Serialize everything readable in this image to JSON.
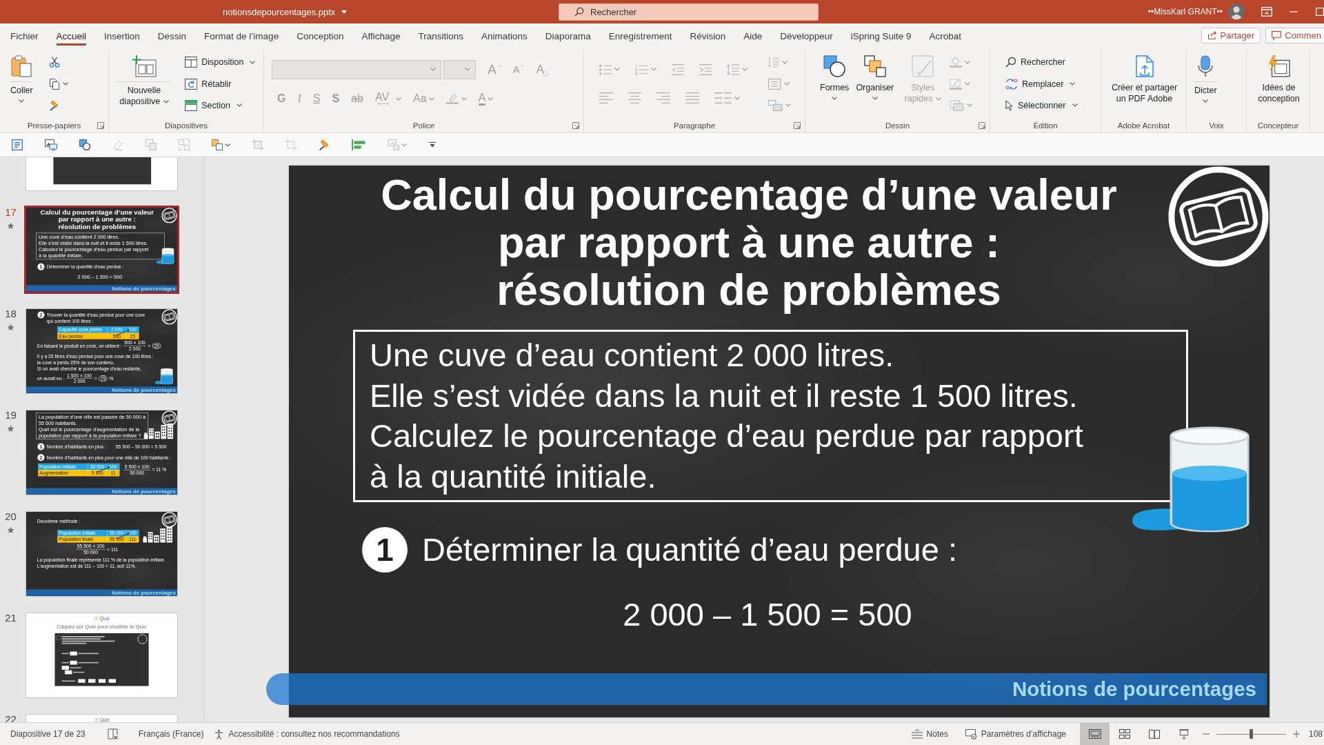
{
  "title_bar": {
    "file_name": "notionsdepourcentages.pptx",
    "search_placeholder": "Rechercher",
    "user_name": "••MissKarl GRANT••"
  },
  "menu_tabs": [
    {
      "label": "Fichier",
      "selected": false
    },
    {
      "label": "Accueil",
      "selected": true
    },
    {
      "label": "Insertion",
      "selected": false
    },
    {
      "label": "Dessin",
      "selected": false
    },
    {
      "label": "Format de l’image",
      "selected": false
    },
    {
      "label": "Conception",
      "selected": false
    },
    {
      "label": "Affichage",
      "selected": false
    },
    {
      "label": "Transitions",
      "selected": false
    },
    {
      "label": "Animations",
      "selected": false
    },
    {
      "label": "Diaporama",
      "selected": false
    },
    {
      "label": "Enregistrement",
      "selected": false
    },
    {
      "label": "Révision",
      "selected": false
    },
    {
      "label": "Aide",
      "selected": false
    },
    {
      "label": "Développeur",
      "selected": false
    },
    {
      "label": "iSpring Suite 9",
      "selected": false
    },
    {
      "label": "Acrobat",
      "selected": false
    }
  ],
  "share_button": "Partager",
  "comments_button": "Commen",
  "ribbon": [
    {
      "label": "Presse-papiers",
      "launcher": true,
      "columns": [
        [
          [
            {
              "kind": "large",
              "label": "Coller",
              "dropdown": true,
              "disabled": false
            }
          ]
        ],
        [
          [
            {
              "kind": "icon",
              "dropdown": false,
              "disabled": false
            }
          ],
          [
            {
              "kind": "icon",
              "dropdown": true,
              "disabled": false
            }
          ],
          [
            {
              "kind": "icon",
              "dropdown": false,
              "disabled": false
            }
          ]
        ]
      ]
    },
    {
      "label": "Diapositives",
      "launcher": false,
      "columns": [
        [
          [
            {
              "kind": "large",
              "label": "Nouvelle diapositive",
              "dropdown": true,
              "disabled": false
            }
          ]
        ],
        [
          [
            {
              "kind": "small",
              "label": "Disposition",
              "dropdown": true,
              "disabled": false
            }
          ],
          [
            {
              "kind": "small",
              "label": "Rétablir",
              "dropdown": false,
              "disabled": false
            }
          ],
          [
            {
              "kind": "small",
              "label": "Section",
              "dropdown": true,
              "disabled": false
            }
          ]
        ]
      ]
    },
    {
      "label": "Police",
      "launcher": true,
      "columns": [
        [
          [
            {
              "kind": "combo",
              "dropdown": true,
              "disabled": true
            },
            {
              "kind": "combo",
              "dropdown": true,
              "disabled": true
            },
            {
              "kind": "glyph",
              "label": "A",
              "dropdown": false,
              "disabled": true
            },
            {
              "kind": "glyph",
              "label": "A",
              "dropdown": false,
              "disabled": true
            },
            {
              "kind": "glyph",
              "label": "A",
              "dropdown": false,
              "disabled": true
            }
          ],
          [
            {
              "kind": "glyph",
              "label": "G",
              "dropdown": false,
              "disabled": true
            },
            {
              "kind": "glyph",
              "label": "I",
              "dropdown": false,
              "disabled": true
            },
            {
              "kind": "glyph",
              "label": "S",
              "dropdown": false,
              "disabled": true
            },
            {
              "kind": "glyph",
              "label": "S",
              "dropdown": false,
              "disabled": true
            },
            {
              "kind": "glyph",
              "label": "ab",
              "dropdown": false,
              "disabled": true
            },
            {
              "kind": "glyph",
              "label": "AV",
              "dropdown": true,
              "disabled": true
            },
            {
              "kind": "glyph",
              "label": "Aa",
              "dropdown": true,
              "disabled": true
            },
            {
              "kind": "icon",
              "dropdown": true,
              "disabled": true
            },
            {
              "kind": "glyph",
              "label": "A",
              "dropdown": true,
              "disabled": true
            }
          ]
        ]
      ]
    },
    {
      "label": "Paragraphe",
      "launcher": true,
      "columns": [
        [
          [
            {
              "kind": "icon",
              "dropdown": true,
              "disabled": true
            },
            {
              "kind": "icon",
              "dropdown": true,
              "disabled": true
            },
            {
              "kind": "icon",
              "dropdown": false,
              "disabled": true
            },
            {
              "kind": "icon",
              "dropdown": false,
              "disabled": true
            },
            {
              "kind": "icon",
              "dropdown": true,
              "disabled": true
            }
          ],
          [
            {
              "kind": "icon",
              "dropdown": false,
              "disabled": true
            },
            {
              "kind": "icon",
              "dropdown": false,
              "disabled": true
            },
            {
              "kind": "icon",
              "dropdown": false,
              "disabled": true
            },
            {
              "kind": "icon",
              "dropdown": false,
              "disabled": true
            },
            {
              "kind": "icon",
              "dropdown": true,
              "disabled": true
            }
          ]
        ],
        [
          [
            {
              "kind": "icon",
              "dropdown": true,
              "disabled": true
            }
          ],
          [
            {
              "kind": "icon",
              "dropdown": true,
              "disabled": true
            }
          ],
          [
            {
              "kind": "icon",
              "dropdown": true,
              "disabled": true
            }
          ]
        ]
      ]
    },
    {
      "label": "Dessin",
      "launcher": true,
      "columns": [
        [
          [
            {
              "kind": "large",
              "label": "Formes",
              "dropdown": true,
              "disabled": false
            }
          ]
        ],
        [
          [
            {
              "kind": "large",
              "label": "Organiser",
              "dropdown": true,
              "disabled": false
            }
          ]
        ],
        [
          [
            {
              "kind": "large",
              "label": "Styles rapides",
              "dropdown": true,
              "disabled": true
            }
          ]
        ],
        [
          [
            {
              "kind": "icon",
              "dropdown": true,
              "disabled": true
            }
          ],
          [
            {
              "kind": "icon",
              "dropdown": true,
              "disabled": true
            }
          ],
          [
            {
              "kind": "icon",
              "dropdown": true,
              "disabled": true
            }
          ]
        ]
      ]
    },
    {
      "label": "Édition",
      "launcher": false,
      "columns": [
        [
          [
            {
              "kind": "small",
              "label": "Rechercher",
              "dropdown": false,
              "disabled": false
            }
          ],
          [
            {
              "kind": "small",
              "label": "Remplacer",
              "dropdown": true,
              "disabled": false
            }
          ],
          [
            {
              "kind": "small",
              "label": "Sélectionner",
              "dropdown": true,
              "disabled": false
            }
          ]
        ]
      ]
    },
    {
      "label": "Adobe Acrobat",
      "launcher": false,
      "columns": [
        [
          [
            {
              "kind": "large",
              "label": "Créer et partager un PDF Adobe",
              "dropdown": false,
              "disabled": false
            }
          ]
        ]
      ]
    },
    {
      "label": "Voix",
      "launcher": false,
      "columns": [
        [
          [
            {
              "kind": "large",
              "label": "Dicter",
              "dropdown": true,
              "disabled": false
            }
          ]
        ]
      ]
    },
    {
      "label": "Concepteur",
      "launcher": false,
      "columns": [
        [
          [
            {
              "kind": "large",
              "label": "Idées de conception",
              "dropdown": false,
              "disabled": false
            }
          ]
        ]
      ]
    }
  ],
  "quick_access": [
    {
      "dropdown": false,
      "disabled": false
    },
    {
      "dropdown": false,
      "disabled": false
    },
    {
      "dropdown": false,
      "disabled": false
    },
    {
      "dropdown": false,
      "disabled": true
    },
    {
      "dropdown": false,
      "disabled": true
    },
    {
      "dropdown": false,
      "disabled": true
    },
    {
      "dropdown": true,
      "disabled": false
    },
    {
      "dropdown": false,
      "disabled": true
    },
    {
      "dropdown": false,
      "disabled": true
    },
    {
      "dropdown": false,
      "disabled": false
    },
    {
      "dropdown": false,
      "disabled": false
    },
    {
      "dropdown": true,
      "disabled": true
    },
    {
      "dropdown": false,
      "disabled": false
    }
  ],
  "thumbnails": [
    {
      "kind": "white",
      "selected": false,
      "animated": false,
      "blocks": [
        {
          "kind": "picture"
        }
      ]
    },
    {
      "number": "17",
      "kind": "chalkboard",
      "selected": true,
      "animated": true,
      "corner_icon": true,
      "footer": "Notions de pourcentages",
      "blocks": [
        {
          "kind": "title",
          "lines": [
            "Calcul du pourcentage d’une valeur",
            "par rapport à une autre :",
            "résolution de problèmes"
          ]
        },
        {
          "kind": "box",
          "figure": {
            "kind": "tank"
          },
          "lines": [
            "Une cuve d’eau contient 2 000 litres.",
            "Elle s’est vidée dans la nuit et il reste 1 500 litres.",
            "Calculez le pourcentage d’eau perdue par rapport",
            "à la quantité initiale."
          ]
        },
        {
          "kind": "step",
          "number": "1",
          "lines": [
            "Déterminer la quantité d’eau perdue :"
          ]
        },
        {
          "kind": "equation",
          "text": "2 000 – 1 500 = 500"
        }
      ]
    },
    {
      "number": "18",
      "kind": "chalkboard",
      "selected": false,
      "animated": true,
      "corner_icon": true,
      "footer": "Notions de pourcentages",
      "blocks": [
        {
          "kind": "step",
          "number": "2",
          "lines": [
            "Trouver la quantité d’eau perdue pour une cuve",
            "qui contient 100 litres :"
          ]
        },
        {
          "kind": "table",
          "arrow": true,
          "rows": [
            {
              "color": "#1ea7e8",
              "cells": [
                "Capacité cuve pleine",
                "2 000",
                "100"
              ]
            },
            {
              "color": "#ffc000",
              "cells": [
                "Eau perdue",
                "500",
                "25"
              ]
            }
          ]
        },
        {
          "kind": "fraction",
          "lead": "En faisant le produit en croix, on obtient :",
          "numerator": "500 × 100",
          "denominator": "2 000",
          "tail": "=",
          "result": "25",
          "circled": true
        },
        {
          "kind": "text",
          "lines": [
            "Il y a 25 litres d’eau perdue pour une cuve de 100 litres :",
            "la cuve a perdu 25% de son contenu.",
            "Si on avait cherché le pourcentage d’eau restante,"
          ]
        },
        {
          "kind": "fraction",
          "figure": {
            "kind": "tank"
          },
          "lead": "on aurait eu :",
          "numerator": "1 500 × 100",
          "denominator": "2 000",
          "tail": "=",
          "result": "75",
          "circled": true,
          "suffix": "%"
        }
      ]
    },
    {
      "number": "19",
      "kind": "chalkboard",
      "selected": false,
      "animated": true,
      "corner_icon": true,
      "footer": "Notions de pourcentages",
      "blocks": [
        {
          "kind": "box",
          "figure": {
            "kind": "buildings"
          },
          "lines": [
            "La population d’une ville est passée de 50 000 à",
            "55 500 habitants.",
            "Quel est le pourcentage d’augmentation de la",
            "population par rapport à la population initiale ?"
          ]
        },
        {
          "kind": "step",
          "number": "1",
          "lines": [
            "Nombre d’habitants en plus :"
          ],
          "equation": "55 500 – 50 000 = 5 500"
        },
        {
          "kind": "step",
          "number": "2",
          "lines": [
            "Nombre d’habitants en plus pour une ville de 100 habitants :"
          ]
        },
        {
          "kind": "row",
          "items": [
            {
              "kind": "table",
              "arrow": true,
              "rows": [
                {
                  "color": "#1ea7e8",
                  "cells": [
                    "Population initiale",
                    "50 000",
                    "100"
                  ]
                },
                {
                  "color": "#ffc000",
                  "cells": [
                    "Augmentation",
                    "5 500",
                    "11"
                  ]
                }
              ]
            },
            {
              "kind": "fraction",
              "numerator": "5 500 × 100",
              "denominator": "50 000",
              "tail": "= 11 %"
            }
          ]
        }
      ]
    },
    {
      "number": "20",
      "kind": "chalkboard",
      "selected": false,
      "animated": true,
      "corner_icon": true,
      "footer": "Notions de pourcentages",
      "blocks": [
        {
          "kind": "text",
          "lines": [
            "Deuxième méthode :"
          ]
        },
        {
          "kind": "table",
          "arrow": true,
          "figure": {
            "kind": "buildings"
          },
          "rows": [
            {
              "color": "#1ea7e8",
              "cells": [
                "Population initiale",
                "50 000",
                "100"
              ]
            },
            {
              "color": "#ffc000",
              "cells": [
                "Population finale",
                "55 500",
                "111"
              ]
            }
          ]
        },
        {
          "kind": "fraction",
          "numerator": "55 500 × 100",
          "denominator": "50 000",
          "tail": "= 111"
        },
        {
          "kind": "text",
          "lines": [
            "La population finale représente 111 % de la population initiale.",
            "L’augmentation est de 111 – 100 = 11, soit 11%."
          ]
        }
      ]
    },
    {
      "number": "21",
      "kind": "white",
      "selected": false,
      "animated": false,
      "blocks": [
        {
          "kind": "quiz",
          "title": "Quiz",
          "hint": "Cliquez sur Quiz pour modifier le Quiz",
          "preview": true
        }
      ]
    },
    {
      "number": "22",
      "kind": "white",
      "selected": false,
      "animated": false,
      "blocks": [
        {
          "kind": "quiz",
          "title": "Quiz"
        }
      ]
    }
  ],
  "slide": {
    "kind": "chalkboard",
    "corner_icon": true,
    "footer": "Notions de pourcentages",
    "blocks": [
      {
        "kind": "title",
        "lines": [
          "Calcul du pourcentage d’une valeur",
          "par rapport à une autre :",
          "résolution de problèmes"
        ]
      },
      {
        "kind": "box",
        "figure": {
          "kind": "tank"
        },
        "lines": [
          "Une cuve d’eau contient 2 000 litres.",
          "Elle s’est vidée dans la nuit et il reste 1 500 litres.",
          "Calculez le pourcentage d’eau perdue par rapport",
          "à la quantité initiale."
        ]
      },
      {
        "kind": "step",
        "number": "1",
        "lines": [
          "Déterminer la quantité d’eau perdue :"
        ]
      },
      {
        "kind": "equation",
        "text": "2 000 – 1 500 = 500"
      }
    ]
  },
  "status_bar": {
    "slide_position": "Diapositive 17 de 23",
    "language": "Français (France)",
    "accessibility": "Accessibilité : consultez nos recommandations",
    "notes": "Notes",
    "display_settings": "Paramètres d’affichage",
    "views": [
      {
        "selected": true
      },
      {
        "selected": false
      },
      {
        "selected": false
      },
      {
        "selected": false
      }
    ],
    "zoom": {
      "level": 0.5,
      "value": "108"
    }
  }
}
